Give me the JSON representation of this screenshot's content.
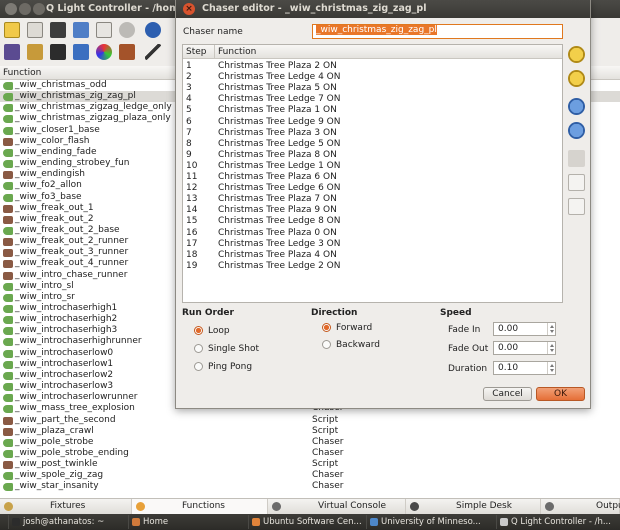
{
  "main_window": {
    "title": "Q Light Controller - /home/josl"
  },
  "function_list": {
    "header": "Function",
    "rows": [
      {
        "name": "_wiw_christmas_odd",
        "type": "",
        "icon": "chaser"
      },
      {
        "name": "_wiw_christmas_zig_zag_pl",
        "type": "",
        "icon": "chaser",
        "selected": true
      },
      {
        "name": "_wiw_christmas_zigzag_ledge_only",
        "type": "",
        "icon": "chaser"
      },
      {
        "name": "_wiw_christmas_zigzag_plaza_only",
        "type": "",
        "icon": "chaser"
      },
      {
        "name": "_wiw_closer1_base",
        "type": "",
        "icon": "chaser"
      },
      {
        "name": "_wiw_color_flash",
        "type": "",
        "icon": "script"
      },
      {
        "name": "_wiw_ending_fade",
        "type": "",
        "icon": "chaser"
      },
      {
        "name": "_wiw_ending_strobey_fun",
        "type": "",
        "icon": "chaser"
      },
      {
        "name": "_wiw_endingish",
        "type": "",
        "icon": "script"
      },
      {
        "name": "_wiw_fo2_allon",
        "type": "",
        "icon": "chaser"
      },
      {
        "name": "_wiw_fo3_base",
        "type": "",
        "icon": "chaser"
      },
      {
        "name": "_wiw_freak_out_1",
        "type": "",
        "icon": "script"
      },
      {
        "name": "_wiw_freak_out_2",
        "type": "",
        "icon": "script"
      },
      {
        "name": "_wiw_freak_out_2_base",
        "type": "",
        "icon": "chaser"
      },
      {
        "name": "_wiw_freak_out_2_runner",
        "type": "",
        "icon": "script"
      },
      {
        "name": "_wiw_freak_out_3_runner",
        "type": "",
        "icon": "script"
      },
      {
        "name": "_wiw_freak_out_4_runner",
        "type": "",
        "icon": "script"
      },
      {
        "name": "_wiw_intro_chase_runner",
        "type": "",
        "icon": "script"
      },
      {
        "name": "_wiw_intro_sl",
        "type": "",
        "icon": "chaser"
      },
      {
        "name": "_wiw_intro_sr",
        "type": "",
        "icon": "chaser"
      },
      {
        "name": "_wiw_introchaserhigh1",
        "type": "",
        "icon": "chaser"
      },
      {
        "name": "_wiw_introchaserhigh2",
        "type": "",
        "icon": "chaser"
      },
      {
        "name": "_wiw_introchaserhigh3",
        "type": "",
        "icon": "chaser"
      },
      {
        "name": "_wiw_introchaserhighrunner",
        "type": "",
        "icon": "chaser"
      },
      {
        "name": "_wiw_introchaserlow0",
        "type": "",
        "icon": "chaser"
      },
      {
        "name": "_wiw_introchaserlow1",
        "type": "",
        "icon": "chaser"
      },
      {
        "name": "_wiw_introchaserlow2",
        "type": "",
        "icon": "chaser"
      },
      {
        "name": "_wiw_introchaserlow3",
        "type": "",
        "icon": "chaser"
      },
      {
        "name": "_wiw_introchaserlowrunner",
        "type": "",
        "icon": "chaser"
      },
      {
        "name": "_wiw_mass_tree_explosion",
        "type": "Chaser",
        "icon": "chaser"
      },
      {
        "name": "_wiw_part_the_second",
        "type": "Script",
        "icon": "script"
      },
      {
        "name": "_wiw_plaza_crawl",
        "type": "Script",
        "icon": "script"
      },
      {
        "name": "_wiw_pole_strobe",
        "type": "Chaser",
        "icon": "chaser"
      },
      {
        "name": "_wiw_pole_strobe_ending",
        "type": "Chaser",
        "icon": "chaser"
      },
      {
        "name": "_wiw_post_twinkle",
        "type": "Script",
        "icon": "script"
      },
      {
        "name": "_wiw_spole_zig_zag",
        "type": "Chaser",
        "icon": "chaser"
      },
      {
        "name": "_wiw_star_insanity",
        "type": "Chaser",
        "icon": "chaser"
      }
    ]
  },
  "bottom_tabs": [
    {
      "label": "Fixtures",
      "icon": "fixtures-icon",
      "active": false
    },
    {
      "label": "Functions",
      "icon": "functions-icon",
      "active": true
    },
    {
      "label": "Virtual Console",
      "icon": "virtual-console-icon",
      "active": false
    },
    {
      "label": "Simple Desk",
      "icon": "simple-desk-icon",
      "active": false
    },
    {
      "label": "Outpu",
      "icon": "output-icon",
      "active": false
    }
  ],
  "taskbar": [
    {
      "label": "josh@athanatos: ~",
      "icon": "terminal-icon"
    },
    {
      "label": "Home",
      "icon": "folder-icon"
    },
    {
      "label": "Ubuntu Software Cen...",
      "icon": "software-center-icon"
    },
    {
      "label": "University of Minneso...",
      "icon": "browser-icon"
    },
    {
      "label": "Q Light Controller - /h...",
      "icon": "qlc-icon"
    }
  ],
  "dialog": {
    "title": "Chaser editor - _wiw_christmas_zig_zag_pl",
    "close_label": "×",
    "chaser_name_label": "Chaser name",
    "chaser_name_value": "_wiw_christmas_zig_zag_pl",
    "steps_header": {
      "step": "Step",
      "function": "Function"
    },
    "steps": [
      {
        "step": "1",
        "function": "Christmas Tree Plaza 2 ON"
      },
      {
        "step": "2",
        "function": "Christmas Tree Ledge 4 ON"
      },
      {
        "step": "3",
        "function": "Christmas Tree Plaza 5 ON"
      },
      {
        "step": "4",
        "function": "Christmas Tree Ledge 7 ON"
      },
      {
        "step": "5",
        "function": "Christmas Tree Plaza 1 ON"
      },
      {
        "step": "6",
        "function": "Christmas Tree Ledge 9 ON"
      },
      {
        "step": "7",
        "function": "Christmas Tree Plaza 3 ON"
      },
      {
        "step": "8",
        "function": "Christmas Tree Ledge 5 ON"
      },
      {
        "step": "9",
        "function": "Christmas Tree Plaza 8 ON"
      },
      {
        "step": "10",
        "function": "Christmas Tree Ledge 1 ON"
      },
      {
        "step": "11",
        "function": "Christmas Tree Plaza 6 ON"
      },
      {
        "step": "12",
        "function": "Christmas Tree Ledge 6 ON"
      },
      {
        "step": "13",
        "function": "Christmas Tree Plaza 7 ON"
      },
      {
        "step": "14",
        "function": "Christmas Tree Plaza 9 ON"
      },
      {
        "step": "15",
        "function": "Christmas Tree Ledge 8 ON"
      },
      {
        "step": "16",
        "function": "Christmas Tree Plaza 0 ON"
      },
      {
        "step": "17",
        "function": "Christmas Tree Ledge 3 ON"
      },
      {
        "step": "18",
        "function": "Christmas Tree Plaza 4 ON"
      },
      {
        "step": "19",
        "function": "Christmas Tree Ledge 2 ON"
      }
    ],
    "run_order": {
      "title": "Run Order",
      "options": [
        "Loop",
        "Single Shot",
        "Ping Pong"
      ],
      "selected": "Loop"
    },
    "direction": {
      "title": "Direction",
      "options": [
        "Forward",
        "Backward"
      ],
      "selected": "Forward"
    },
    "speed": {
      "title": "Speed",
      "fade_in_label": "Fade In",
      "fade_in_value": "0.00",
      "fade_out_label": "Fade Out",
      "fade_out_value": "0.00",
      "duration_label": "Duration",
      "duration_value": "0.10"
    },
    "cancel_label": "Cancel",
    "ok_label": "OK"
  },
  "colors": {
    "accent": "#e56f37",
    "titlebar": "#3c3b37",
    "chaser_icon": "#6aa84f",
    "script_icon": "#8a5a44"
  }
}
